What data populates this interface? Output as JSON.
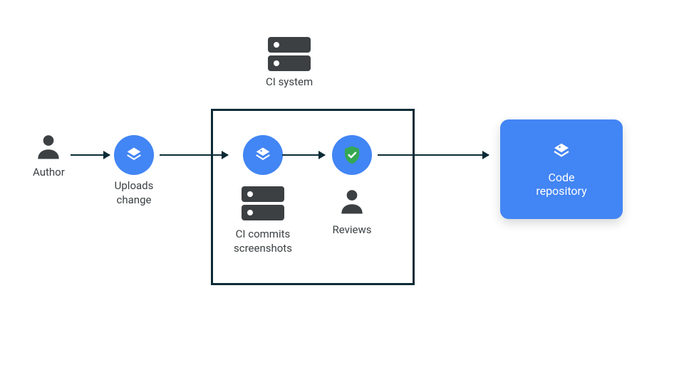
{
  "nodes": {
    "author": {
      "label": "Author"
    },
    "uploads": {
      "label": "Uploads\nchange"
    },
    "ci_system": {
      "label": "CI system"
    },
    "ci_commits": {
      "label": "CI commits\nscreenshots"
    },
    "reviews": {
      "label": "Reviews"
    },
    "repo_icon": {
      "name": "stack-icon"
    },
    "repo": {
      "label": "Code\nrepository"
    }
  },
  "colors": {
    "accent": "#4285f4",
    "dark": "#3c4043",
    "outline": "#0b2b36",
    "shield": "#34a853"
  }
}
